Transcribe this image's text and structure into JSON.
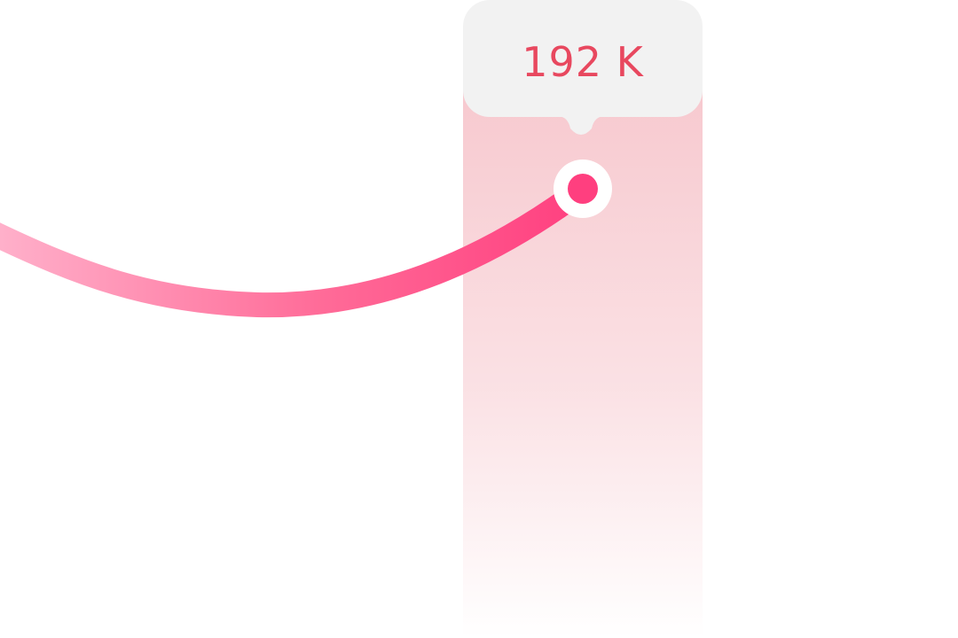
{
  "tooltip": {
    "value_label": "192 K"
  },
  "colors": {
    "accent": "#FF3F7F",
    "accent_light": "#FFB0CA",
    "tooltip_text": "#E8485F",
    "tooltip_bg": "#F2F2F2",
    "highlight_band": "#F7C9CF",
    "marker_ring": "#FFFFFF"
  },
  "icons": {
    "marker": "data-point-marker",
    "pointer": "tooltip-pointer"
  }
}
